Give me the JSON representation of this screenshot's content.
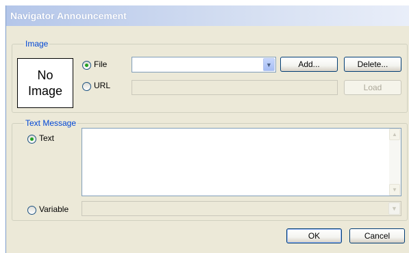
{
  "window": {
    "title": "Navigator Announcement"
  },
  "image_group": {
    "label": "Image",
    "placeholder_line1": "No",
    "placeholder_line2": "Image",
    "file_radio_label": "File",
    "file_selected": true,
    "file_value": "",
    "url_radio_label": "URL",
    "url_value": "",
    "add_button": "Add...",
    "delete_button": "Delete...",
    "load_button": "Load"
  },
  "text_group": {
    "label": "Text Message",
    "text_radio_label": "Text",
    "text_selected": true,
    "text_value": "",
    "variable_radio_label": "Variable",
    "variable_value": ""
  },
  "footer": {
    "ok_button": "OK",
    "cancel_button": "Cancel"
  }
}
